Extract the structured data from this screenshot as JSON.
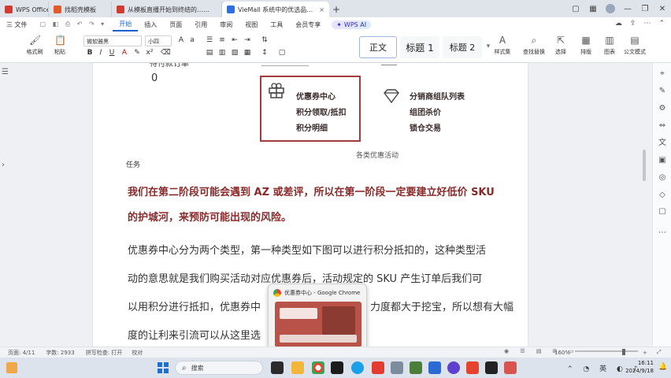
{
  "titlebar": {
    "tabs": [
      {
        "label": "WPS Office",
        "color": "#d23b2f",
        "active": false
      },
      {
        "label": "找稻壳模板",
        "color": "#e05a2b",
        "active": false
      },
      {
        "label": "从模板直播开始到终结的……",
        "color": "#d23b2f",
        "active": false
      },
      {
        "label": "VieMall 系统中的优选品.docx",
        "color": "#2d6ee0",
        "active": true
      }
    ],
    "new_tab": "+"
  },
  "menu": {
    "items": [
      "三 文件",
      "开始",
      "插入",
      "页面",
      "引用",
      "审阅",
      "视图",
      "工具",
      "会员专享"
    ],
    "active_index": 1,
    "ai_label": "WPS AI"
  },
  "ribbon": {
    "font_name": "微软雅黑",
    "font_size": "小四",
    "left_buttons": [
      "格式刷",
      "粘贴"
    ],
    "styles": [
      "正文",
      "标题 1",
      "标题 2"
    ],
    "right_buttons": [
      "样式集",
      "查找替换",
      "选择",
      "排版",
      "图表",
      "公文模式"
    ]
  },
  "doc": {
    "partial_top_label": "待付款订单",
    "partial_top_value": "0",
    "activity": {
      "coupon": [
        "优惠券中心",
        "积分领取/抵扣",
        "积分明细"
      ],
      "distribution": [
        "分销商组队列表",
        "组团杀价",
        "锁仓交易"
      ],
      "caption": "各类优惠活动"
    },
    "task_label": "任务",
    "paragraphs": [
      "我们在第二阶段可能会遇到 AZ 或差评，所以在第一阶段一定要建立好低价 SKU",
      "的护城河，来预防可能出现的风险。",
      "优惠券中心分为两个类型，第一种类型如下图可以进行积分抵扣的，这种类型活",
      "动的意思就是我们购买活动对应优惠券后，活动规定的 SKU 产生订单后我们可",
      "以用积分进行抵扣，优惠券中",
      "度的让利来引流可以从这里选"
    ],
    "para_tail": "力度都大于挖宝，所以想有大幅"
  },
  "preview": {
    "title": "优惠券中心 - Google Chrome"
  },
  "status": {
    "page": "页面: 4/11",
    "words": "字数: 2933",
    "spell": "拼写检查: 打开",
    "proof": "校对",
    "zoom": "160%"
  },
  "taskbar": {
    "search": "搜索",
    "time": "16:11",
    "date": "2024/9/18"
  }
}
